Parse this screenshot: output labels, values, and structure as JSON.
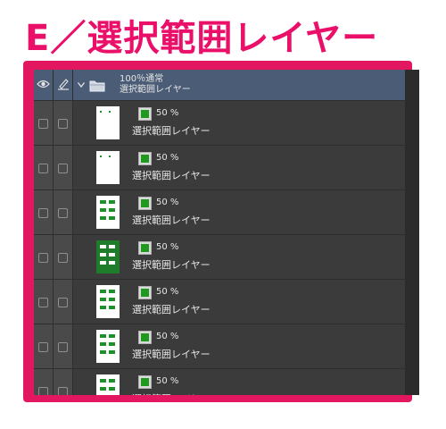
{
  "title": "E／選択範囲レイヤー",
  "colors": {
    "accent": "#e3175f",
    "panel": "#3b3b3b",
    "folder_row": "#4a5c76",
    "mask_green": "#1f9a1f"
  },
  "header": {
    "visibility_icon": "eye-icon",
    "edit_icon": "pen-icon"
  },
  "folder": {
    "opacity_mode": "100％通常",
    "name": "選択範囲レイヤー",
    "icon": "folder-icon",
    "expand_icon": "chevron-down-icon"
  },
  "layers": [
    {
      "opacity": "50 %",
      "name": "選択範囲レイヤー",
      "thumb": "light"
    },
    {
      "opacity": "50 %",
      "name": "選択範囲レイヤー",
      "thumb": "light"
    },
    {
      "opacity": "50 %",
      "name": "選択範囲レイヤー",
      "thumb": "light"
    },
    {
      "opacity": "50 %",
      "name": "選択範囲レイヤー",
      "thumb": "dark"
    },
    {
      "opacity": "50 %",
      "name": "選択範囲レイヤー",
      "thumb": "light"
    },
    {
      "opacity": "50 %",
      "name": "選択範囲レイヤー",
      "thumb": "light"
    },
    {
      "opacity": "50 %",
      "name": "選択範囲レイヤー",
      "thumb": "light"
    }
  ]
}
